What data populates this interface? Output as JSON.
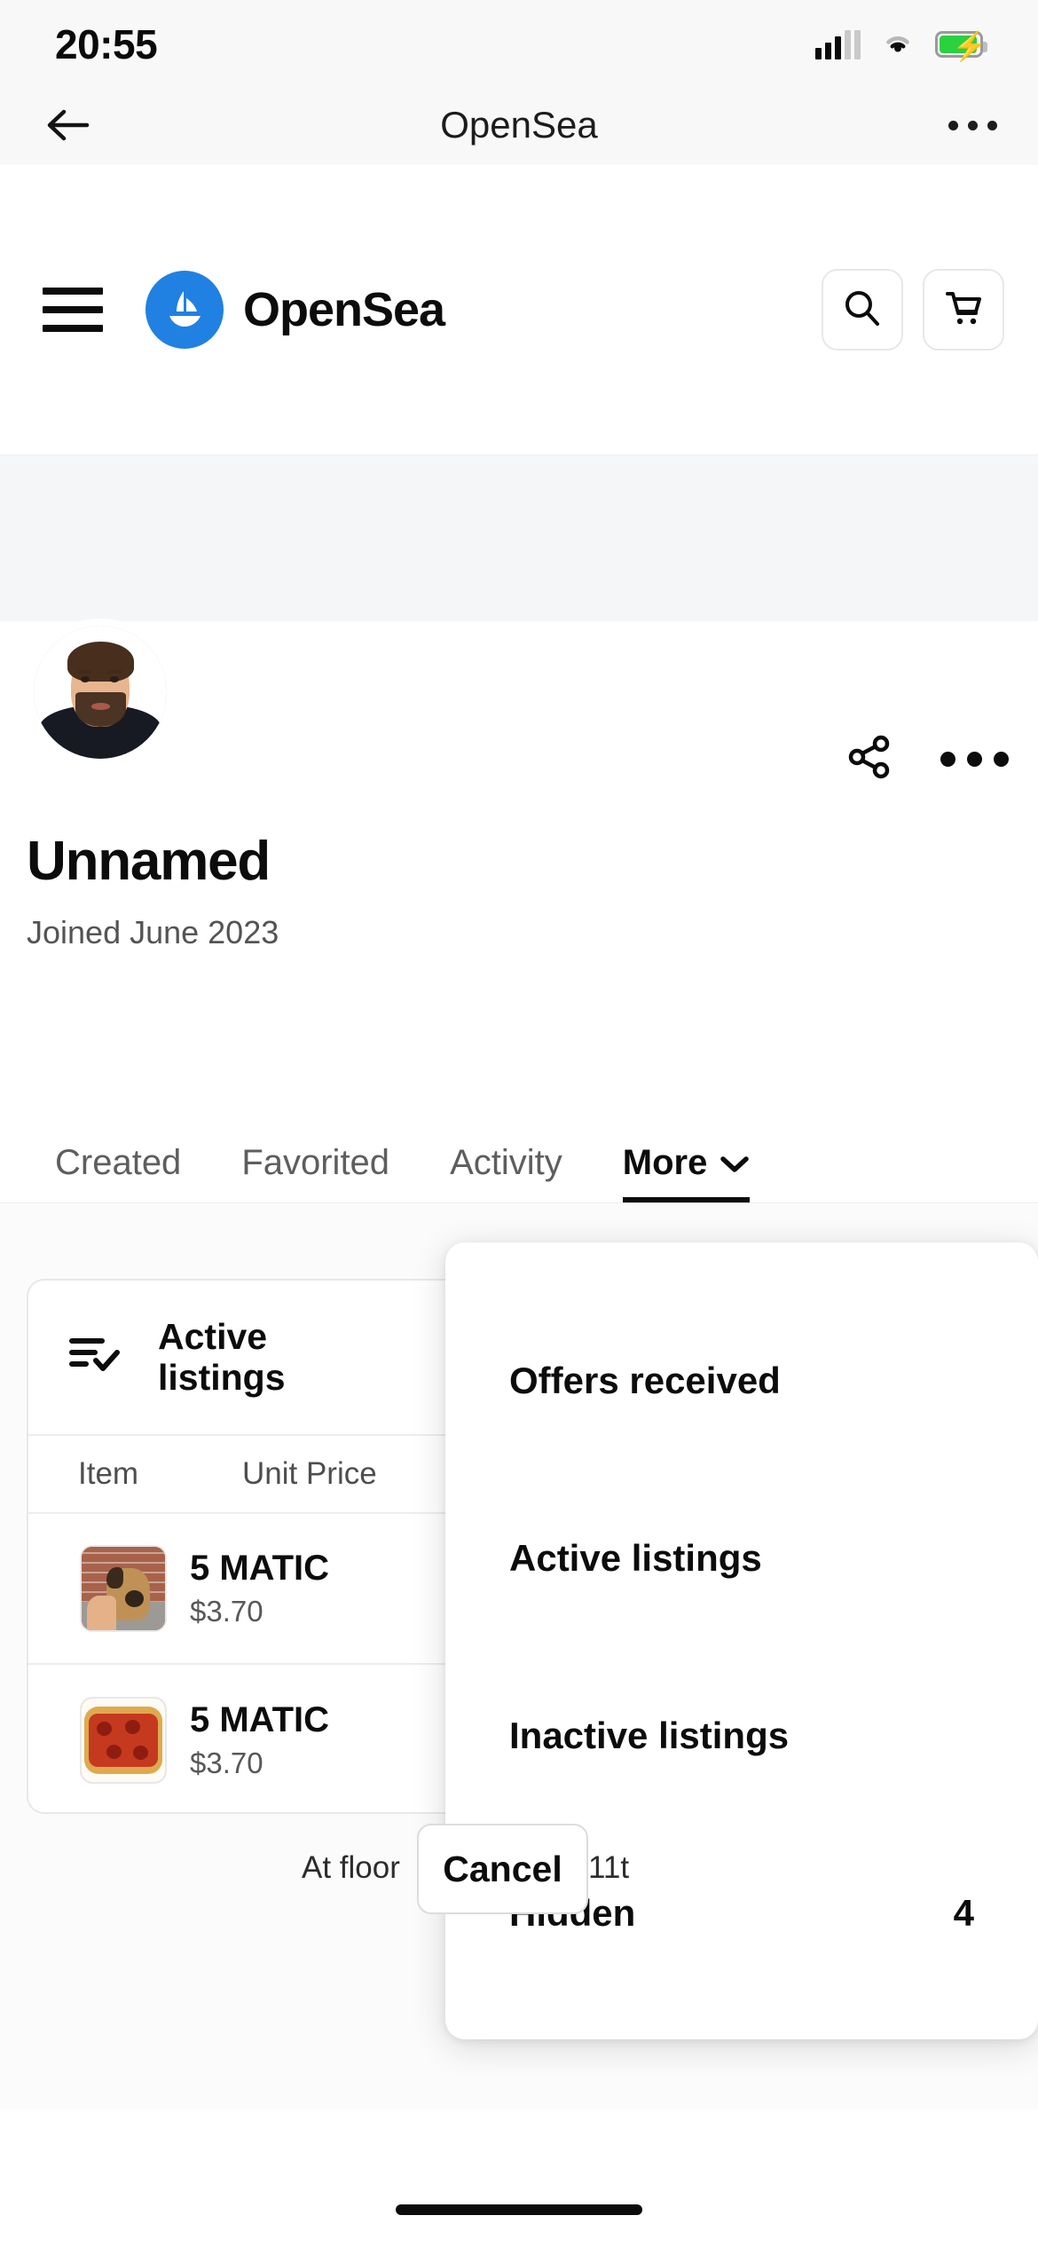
{
  "status_bar": {
    "time": "20:55",
    "signal_icon": "signal-bars-icon",
    "wifi_icon": "wifi-icon",
    "battery_icon": "battery-charging-icon",
    "battery_color": "#2bd13f"
  },
  "browser_nav": {
    "back_icon": "back-arrow-icon",
    "title": "OpenSea",
    "overflow_icon": "three-dots-icon"
  },
  "site_header": {
    "menu_icon": "hamburger-menu-icon",
    "logo_icon": "opensea-ship-logo-icon",
    "brand": "OpenSea",
    "brand_color": "#2081e2",
    "search_icon": "search-icon",
    "cart_icon": "shopping-cart-icon"
  },
  "profile": {
    "avatar_icon": "user-avatar",
    "share_icon": "share-icon",
    "more_icon": "three-dots-icon",
    "name": "Unnamed",
    "joined": "Joined June 2023"
  },
  "tabs": [
    {
      "label": "Created",
      "active": false
    },
    {
      "label": "Favorited",
      "active": false
    },
    {
      "label": "Activity",
      "active": false
    },
    {
      "label": "More",
      "active": true,
      "chevron_icon": "chevron-down-icon"
    }
  ],
  "listings_card": {
    "header_icon": "list-check-icon",
    "title": "Active listings",
    "columns": [
      "Item",
      "Unit Price"
    ],
    "rows": [
      {
        "thumb_icon": "nft-thumbnail-dog",
        "unit_price": "5 MATIC",
        "unit_price_usd": "$3.70",
        "floor": "",
        "expiration": ""
      },
      {
        "thumb_icon": "nft-thumbnail-pizza",
        "unit_price": "5 MATIC",
        "unit_price_usd": "$3.70",
        "floor": "At floor",
        "expiration": "11t",
        "action_label": "Cancel"
      }
    ]
  },
  "dropdown": {
    "items": [
      {
        "label": "Offers received",
        "count": ""
      },
      {
        "label": "Active listings",
        "count": ""
      },
      {
        "label": "Inactive listings",
        "count": ""
      },
      {
        "label": "Hidden",
        "count": "4"
      }
    ]
  },
  "home_indicator": "home-indicator"
}
